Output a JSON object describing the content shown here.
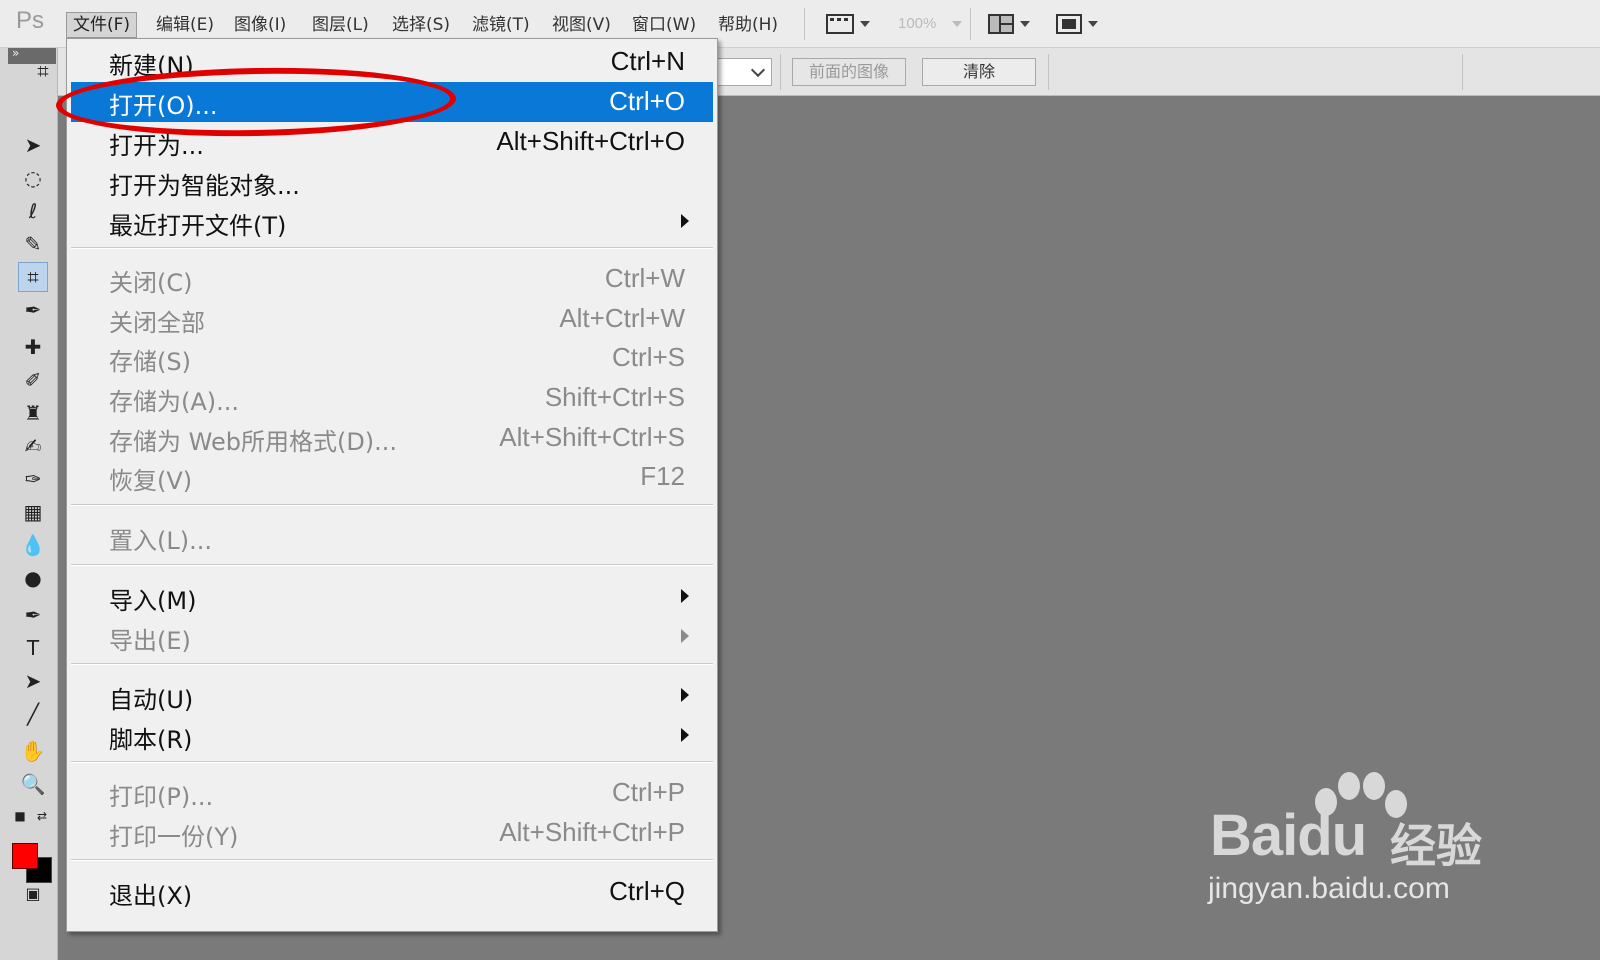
{
  "app": {
    "logo": "Ps",
    "zoom": "100%"
  },
  "menubar": {
    "items": [
      "文件(F)",
      "编辑(E)",
      "图像(I)",
      "图层(L)",
      "选择(S)",
      "滤镜(T)",
      "视图(V)",
      "窗口(W)",
      "帮助(H)"
    ],
    "active_index": 0
  },
  "options_bar": {
    "front_image_label": "前面的图像",
    "clear_label": "清除"
  },
  "file_menu": {
    "items": [
      {
        "label": "新建(N)...",
        "shortcut": "Ctrl+N",
        "enabled": true,
        "submenu": false
      },
      {
        "label": "打开(O)...",
        "shortcut": "Ctrl+O",
        "enabled": true,
        "submenu": false,
        "highlighted": true
      },
      {
        "label": "打开为...",
        "shortcut": "Alt+Shift+Ctrl+O",
        "enabled": true,
        "submenu": false
      },
      {
        "label": "打开为智能对象...",
        "shortcut": "",
        "enabled": true,
        "submenu": false
      },
      {
        "label": "最近打开文件(T)",
        "shortcut": "",
        "enabled": true,
        "submenu": true
      },
      {
        "label": "关闭(C)",
        "shortcut": "Ctrl+W",
        "enabled": false,
        "submenu": false
      },
      {
        "label": "关闭全部",
        "shortcut": "Alt+Ctrl+W",
        "enabled": false,
        "submenu": false
      },
      {
        "label": "存储(S)",
        "shortcut": "Ctrl+S",
        "enabled": false,
        "submenu": false
      },
      {
        "label": "存储为(A)...",
        "shortcut": "Shift+Ctrl+S",
        "enabled": false,
        "submenu": false
      },
      {
        "label": "存储为 Web所用格式(D)...",
        "shortcut": "Alt+Shift+Ctrl+S",
        "enabled": false,
        "submenu": false
      },
      {
        "label": "恢复(V)",
        "shortcut": "F12",
        "enabled": false,
        "submenu": false
      },
      {
        "label": "置入(L)...",
        "shortcut": "",
        "enabled": false,
        "submenu": false
      },
      {
        "label": "导入(M)",
        "shortcut": "",
        "enabled": true,
        "submenu": true
      },
      {
        "label": "导出(E)",
        "shortcut": "",
        "enabled": false,
        "submenu": true
      },
      {
        "label": "自动(U)",
        "shortcut": "",
        "enabled": true,
        "submenu": true
      },
      {
        "label": "脚本(R)",
        "shortcut": "",
        "enabled": true,
        "submenu": true
      },
      {
        "label": "打印(P)...",
        "shortcut": "Ctrl+P",
        "enabled": false,
        "submenu": false
      },
      {
        "label": "打印一份(Y)",
        "shortcut": "Alt+Shift+Ctrl+P",
        "enabled": false,
        "submenu": false
      },
      {
        "label": "退出(X)",
        "shortcut": "Ctrl+Q",
        "enabled": true,
        "submenu": false
      }
    ]
  },
  "colors": {
    "foreground": "#ff0000",
    "background": "#000000",
    "highlight": "#0a78d7",
    "annotation": "#e00000"
  },
  "watermark": {
    "brand": "Bai",
    "brand2": "du",
    "suffix": "经验",
    "url": "jingyan.baidu.com"
  }
}
